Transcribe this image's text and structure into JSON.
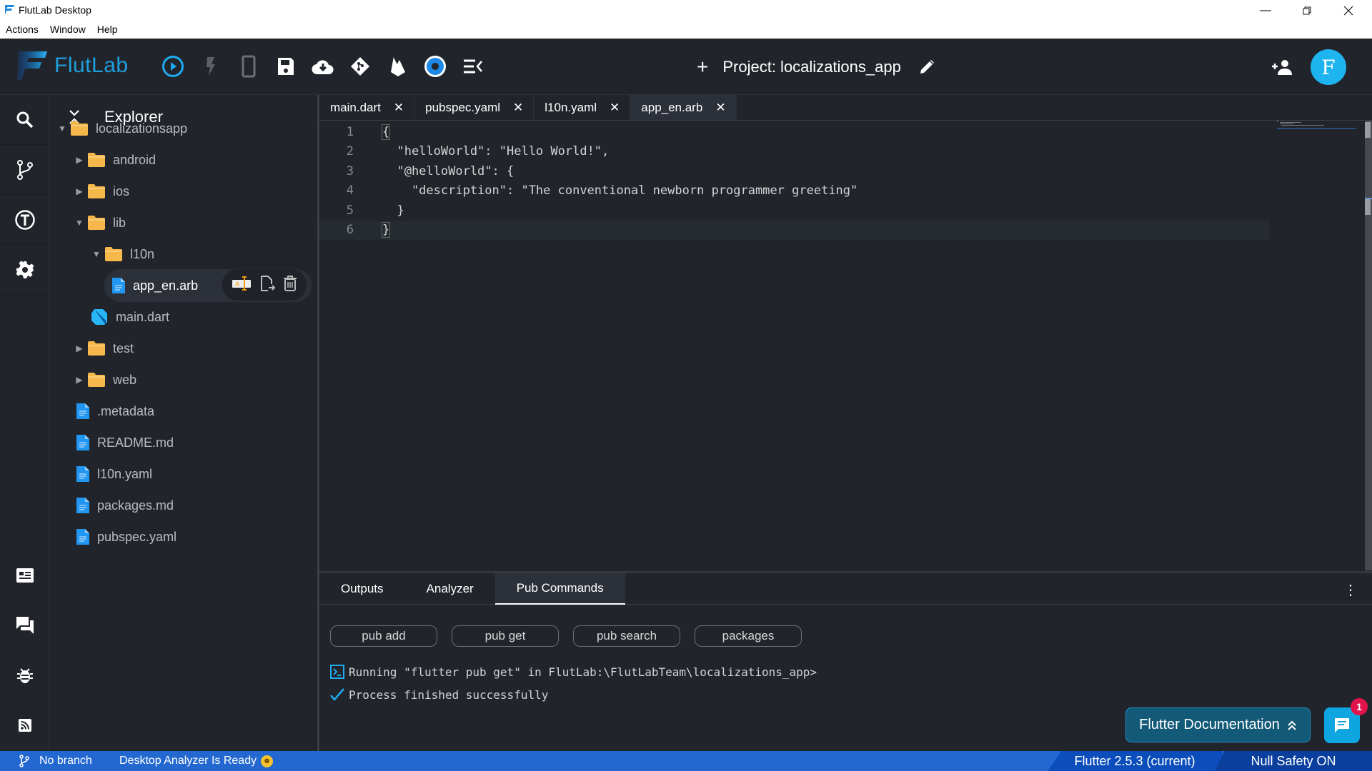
{
  "window": {
    "title": "FlutLab Desktop",
    "menu": [
      "Actions",
      "Window",
      "Help"
    ]
  },
  "toolbar": {
    "logo_text": "FlutLab",
    "icons": [
      "run-icon",
      "hot-reload-icon",
      "device-icon",
      "save-icon",
      "download-icon",
      "git-icon",
      "firebase-icon",
      "settings-circle-icon",
      "collapse-menu-icon"
    ],
    "project_label": "Project: localizations_app",
    "avatar_letter": "F"
  },
  "rail": {
    "top_icons": [
      "search-icon",
      "source-control-icon",
      "tests-icon",
      "settings-icon"
    ],
    "bottom_icons": [
      "news-icon",
      "forum-icon",
      "debug-icon",
      "rss-icon"
    ]
  },
  "explorer": {
    "title": "Explorer",
    "tree": [
      {
        "name": "localizationsapp",
        "type": "folder",
        "expanded": true,
        "depth": 0
      },
      {
        "name": "android",
        "type": "folder",
        "expanded": false,
        "depth": 1
      },
      {
        "name": "ios",
        "type": "folder",
        "expanded": false,
        "depth": 1
      },
      {
        "name": "lib",
        "type": "folder",
        "expanded": true,
        "depth": 1
      },
      {
        "name": "l10n",
        "type": "folder",
        "expanded": true,
        "depth": 2
      },
      {
        "name": "app_en.arb",
        "type": "file",
        "depth": 3,
        "selected": true
      },
      {
        "name": "main.dart",
        "type": "dart",
        "depth": 2
      },
      {
        "name": "test",
        "type": "folder",
        "expanded": false,
        "depth": 1
      },
      {
        "name": "web",
        "type": "folder",
        "expanded": false,
        "depth": 1
      },
      {
        "name": ".metadata",
        "type": "file",
        "depth": 1
      },
      {
        "name": "README.md",
        "type": "file",
        "depth": 1
      },
      {
        "name": "l10n.yaml",
        "type": "file",
        "depth": 1
      },
      {
        "name": "packages.md",
        "type": "file",
        "depth": 1
      },
      {
        "name": "pubspec.yaml",
        "type": "file",
        "depth": 1
      }
    ],
    "row_actions": [
      "rename-icon",
      "move-file-icon",
      "delete-icon"
    ]
  },
  "editor": {
    "tabs": [
      {
        "label": "main.dart",
        "active": false
      },
      {
        "label": "pubspec.yaml",
        "active": false
      },
      {
        "label": "l10n.yaml",
        "active": false
      },
      {
        "label": "app_en.arb",
        "active": true
      }
    ],
    "lines": [
      "{",
      "  \"helloWorld\": \"Hello World!\",",
      "  \"@helloWorld\": {",
      "    \"description\": \"The conventional newborn programmer greeting\"",
      "  }",
      "}"
    ],
    "current_line": 6
  },
  "panel": {
    "tabs": [
      {
        "label": "Outputs",
        "active": false
      },
      {
        "label": "Analyzer",
        "active": false
      },
      {
        "label": "Pub Commands",
        "active": true
      }
    ],
    "buttons": [
      "pub add",
      "pub get",
      "pub search",
      "packages"
    ],
    "log": [
      {
        "icon": "terminal-icon",
        "text": "Running \"flutter pub get\" in FlutLab:\\FlutLabTeam\\localizations_app>"
      },
      {
        "icon": "check-icon",
        "text": "Process finished successfully"
      }
    ]
  },
  "floating": {
    "doc_button": "Flutter Documentation",
    "chat_badge": "1"
  },
  "statusbar": {
    "branch": "No branch",
    "analyzer": "Desktop Analyzer Is Ready",
    "flutter_version": "Flutter 2.5.3 (current)",
    "null_safety": "Null Safety ON"
  },
  "colors": {
    "accent": "#1e9fdc",
    "status_bar": "#2368d0",
    "folder": "#f7b84b",
    "file": "#2196f3"
  }
}
